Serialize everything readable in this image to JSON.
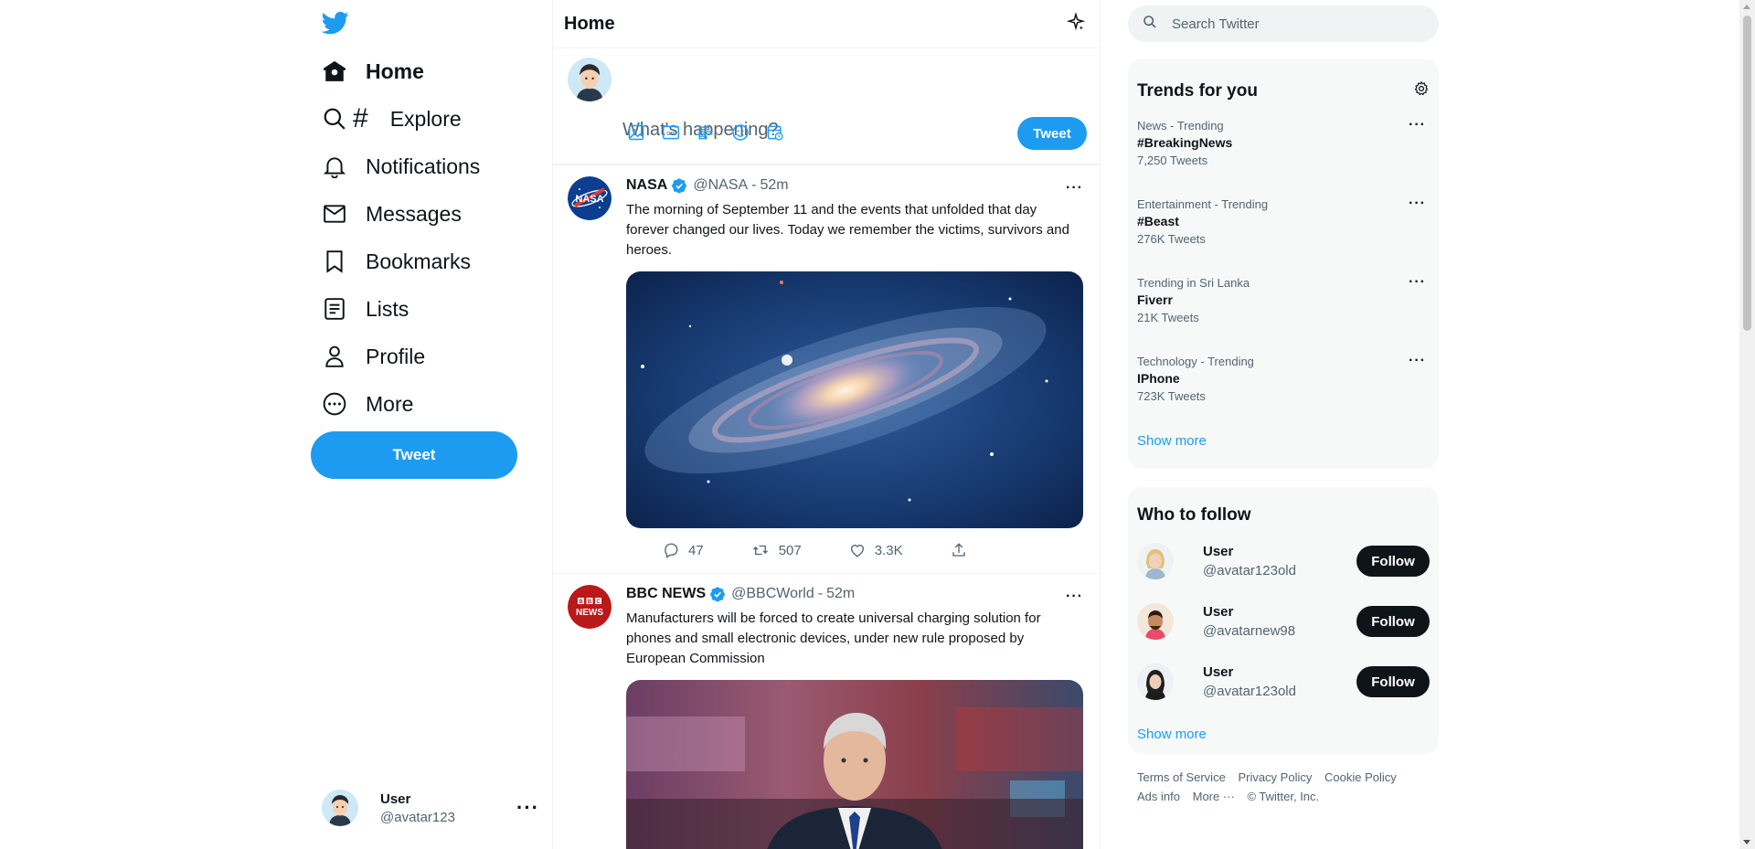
{
  "nav": {
    "items": [
      {
        "label": "Home"
      },
      {
        "label": "Explore"
      },
      {
        "label": "Notifications"
      },
      {
        "label": "Messages"
      },
      {
        "label": "Bookmarks"
      },
      {
        "label": "Lists"
      },
      {
        "label": "Profile"
      },
      {
        "label": "More"
      }
    ],
    "tweet_button": "Tweet",
    "account": {
      "name": "User",
      "handle": "@avatar123"
    }
  },
  "center": {
    "title": "Home",
    "composer": {
      "placeholder": "What's happening?",
      "tweet_button": "Tweet"
    },
    "tweets": [
      {
        "name": "NASA",
        "handle": "@NASA",
        "time": "52m",
        "text": "The morning of September 11 and the events that unfolded that day forever changed our lives. Today we remember the victims, survivors and heroes.",
        "replies": "47",
        "retweets": "507",
        "likes": "3.3K"
      },
      {
        "name": "BBC NEWS",
        "handle": "@BBCWorld",
        "time": "52m",
        "text": "Manufacturers will be forced to create universal charging solution for phones and small electronic devices, under new rule proposed by European Commission"
      }
    ]
  },
  "right": {
    "search_placeholder": "Search Twitter",
    "trends": {
      "title": "Trends for you",
      "items": [
        {
          "meta": "News - Trending",
          "name": "#BreakingNews",
          "count": "7,250 Tweets"
        },
        {
          "meta": "Entertainment - Trending",
          "name": "#Beast",
          "count": "276K Tweets"
        },
        {
          "meta": "Trending in Sri Lanka",
          "name": "Fiverr",
          "count": "21K Tweets"
        },
        {
          "meta": "Technology - Trending",
          "name": "IPhone",
          "count": "723K Tweets"
        }
      ],
      "show_more": "Show more"
    },
    "who_to_follow": {
      "title": "Who to follow",
      "items": [
        {
          "name": "User",
          "handle": "@avatar123old",
          "button": "Follow"
        },
        {
          "name": "User",
          "handle": "@avatarnew98",
          "button": "Follow"
        },
        {
          "name": "User",
          "handle": "@avatar123old",
          "button": "Follow"
        }
      ],
      "show_more": "Show more"
    },
    "footer": {
      "links": [
        "Terms of Service",
        "Privacy Policy",
        "Cookie Policy",
        "Ads info",
        "More ···",
        "© Twitter, Inc."
      ]
    }
  },
  "colors": {
    "accent": "#1d9bf0",
    "text": "#0f1419",
    "muted": "#536471",
    "panel": "#f7f9f9"
  }
}
